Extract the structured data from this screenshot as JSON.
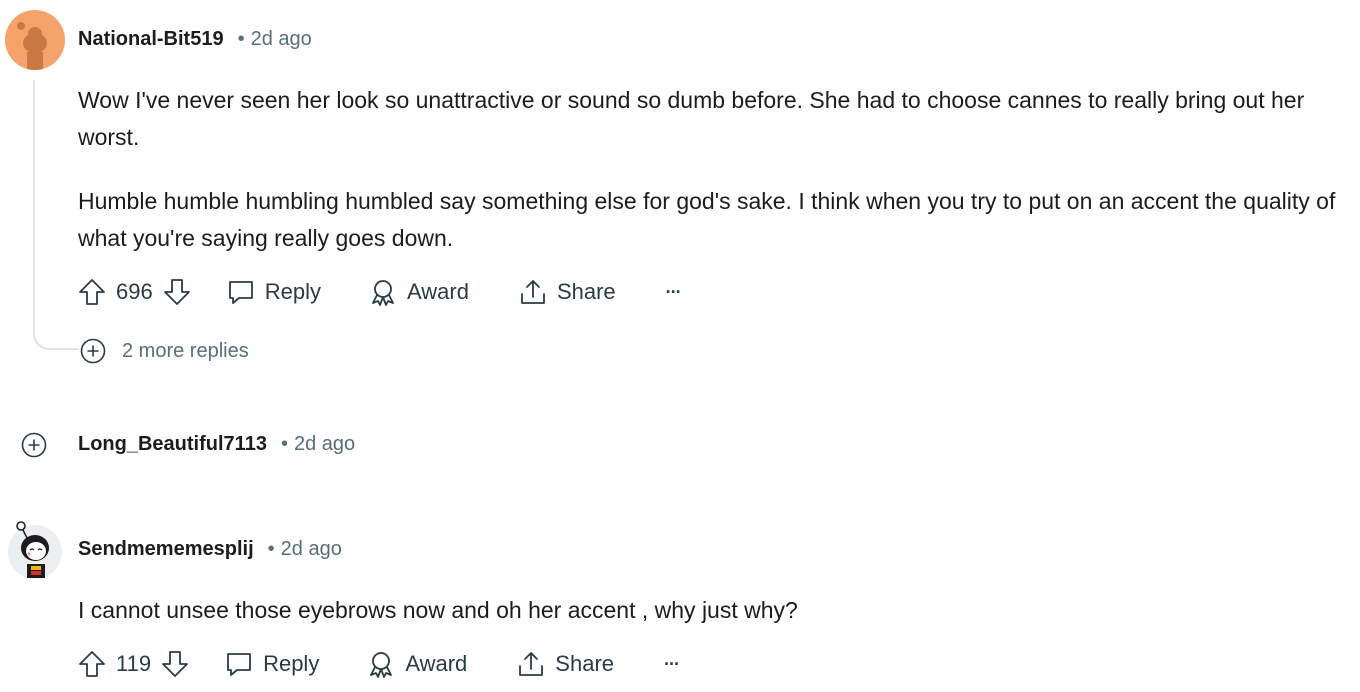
{
  "comments": [
    {
      "author": "National-Bit519",
      "time": "2d ago",
      "paragraphs": [
        "Wow I've never seen her look so unattractive or sound so dumb before. She had to choose cannes to really bring out her worst.",
        "Humble humble humbling humbled say something else for god's sake. I think when you try to put on an accent the quality of what you're saying really goes down."
      ],
      "votes": "696",
      "more_replies": "2 more replies"
    },
    {
      "author": "Long_Beautiful7113",
      "time": "2d ago"
    },
    {
      "author": "Sendmememesplij",
      "time": "2d ago",
      "paragraphs": [
        "I cannot unsee those eyebrows now and oh her accent , why just why?"
      ],
      "votes": "119"
    }
  ],
  "actions": {
    "reply": "Reply",
    "award": "Award",
    "share": "Share",
    "more": "···"
  },
  "colors": {
    "meta": "#576f76",
    "thread_line": "#e0e4e6",
    "avatar_orange": "#f4a46a"
  },
  "icons": [
    "upvote-icon",
    "downvote-icon",
    "comment-icon",
    "award-icon",
    "share-icon",
    "more-icon",
    "expand-icon",
    "avatar-icon"
  ]
}
